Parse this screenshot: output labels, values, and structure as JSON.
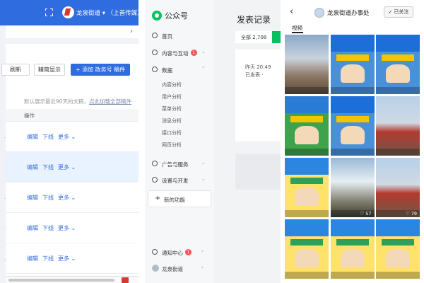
{
  "panel1": {
    "header": {
      "account_label": "龙泉街道 ▾ （上善传媒）"
    },
    "toolbar": {
      "refresh_label": "刷新",
      "simple_view_label": "精简显示",
      "add_label": "+ 添加 政务号 稿件"
    },
    "notice": {
      "text": "默认展示最近90天的文稿，",
      "link": "点此加载全部稿件"
    },
    "table": {
      "header_action": "操作",
      "rows": [
        {
          "edit": "编辑",
          "offline": "下线",
          "more": "更多"
        },
        {
          "edit": "编辑",
          "offline": "下线",
          "more": "更多"
        },
        {
          "edit": "编辑",
          "offline": "下线",
          "more": "更多"
        },
        {
          "edit": "编辑",
          "offline": "下线",
          "more": "更多"
        },
        {
          "edit": "编辑",
          "offline": "下线",
          "more": "更多"
        }
      ]
    }
  },
  "panel2": {
    "brand": "公众号",
    "nav": {
      "home": "首页",
      "content": "内容与互动",
      "content_badge": "1",
      "data": "数据",
      "data_sub": [
        "内容分析",
        "用户分析",
        "菜单分析",
        "消息分析",
        "接口分析",
        "网页分析"
      ],
      "ads": "广告与服务",
      "settings": "设置与开发",
      "new_function": "新的功能",
      "notifications": "通知中心",
      "notifications_badge": "1",
      "account": "龙泉街道"
    },
    "main": {
      "title": "发表记录",
      "filter_all": "全部 2,708",
      "record_time": "昨天 20:49",
      "record_status": "已发表 ·"
    }
  },
  "panel3": {
    "profile_name": "龙泉街道办事处",
    "follow_label": "✓ 已关注",
    "tab_video": "视频",
    "tiles": [
      {
        "style": "photo",
        "count": ""
      },
      {
        "style": "blue",
        "count": ""
      },
      {
        "style": "blue",
        "count": ""
      },
      {
        "style": "green",
        "count": ""
      },
      {
        "style": "blue",
        "count": ""
      },
      {
        "style": "red",
        "count": ""
      },
      {
        "style": "yellow",
        "count": ""
      },
      {
        "style": "park",
        "count": "♡ 57"
      },
      {
        "style": "red",
        "count": "♡ 79"
      },
      {
        "style": "yellow",
        "count": ""
      },
      {
        "style": "yellow",
        "count": ""
      },
      {
        "style": "yellow",
        "count": ""
      }
    ]
  },
  "colors": {
    "accent_blue": "#2f6ce0",
    "wechat_green": "#07c160",
    "badge_red": "#fa5151"
  }
}
